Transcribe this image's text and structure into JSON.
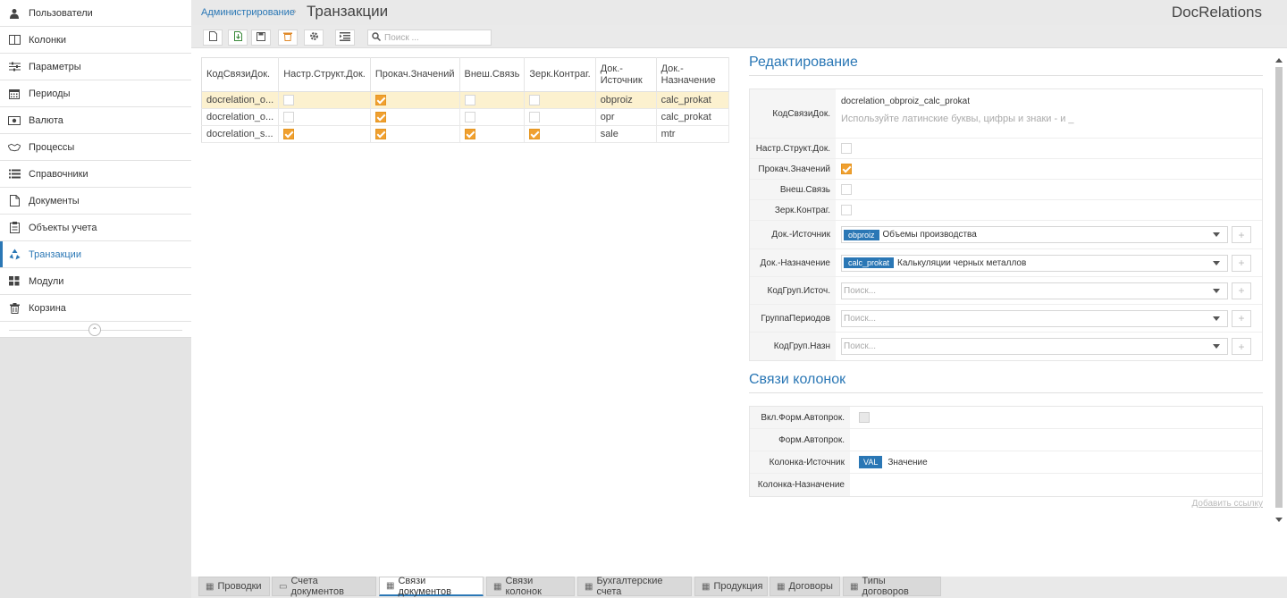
{
  "sidebar": {
    "items": [
      {
        "label": "Пользователи",
        "icon": "user-icon"
      },
      {
        "label": "Колонки",
        "icon": "columns-icon"
      },
      {
        "label": "Параметры",
        "icon": "sliders-icon"
      },
      {
        "label": "Периоды",
        "icon": "calendar-icon"
      },
      {
        "label": "Валюта",
        "icon": "money-icon"
      },
      {
        "label": "Процессы",
        "icon": "handshake-icon"
      },
      {
        "label": "Справочники",
        "icon": "list-icon"
      },
      {
        "label": "Документы",
        "icon": "document-icon"
      },
      {
        "label": "Объекты учета",
        "icon": "clipboard-icon"
      },
      {
        "label": "Транзакции",
        "icon": "recycle-icon",
        "active": true
      },
      {
        "label": "Модули",
        "icon": "grid-icon"
      },
      {
        "label": "Корзина",
        "icon": "trash-icon"
      }
    ]
  },
  "header": {
    "breadcrumb": "Администрирование",
    "separator": "›",
    "title": "Транзакции",
    "brand": "DocRelations"
  },
  "toolbar": {
    "search_placeholder": "Поиск ..."
  },
  "grid": {
    "columns": [
      "КодСвязиДок.",
      "Настр.Структ.Док.",
      "Прокач.Значений",
      "Внеш.Связь",
      "Зерк.Контраг.",
      "Док.-Источник",
      "Док.-Назначение"
    ],
    "rows": [
      {
        "code": "docrelation_o...",
        "nastr": false,
        "prokach": true,
        "vnesh": false,
        "zerk": false,
        "src": "obproiz",
        "dst": "calc_prokat",
        "selected": true
      },
      {
        "code": "docrelation_o...",
        "nastr": false,
        "prokach": true,
        "vnesh": false,
        "zerk": false,
        "src": "opr",
        "dst": "calc_prokat",
        "selected": false
      },
      {
        "code": "docrelation_s...",
        "nastr": true,
        "prokach": true,
        "vnesh": true,
        "zerk": true,
        "src": "sale",
        "dst": "mtr",
        "selected": false
      }
    ]
  },
  "edit": {
    "title": "Редактирование",
    "code_label": "КодСвязиДок.",
    "code_value": "docrelation_obproiz_calc_prokat",
    "code_hint": "Используйте латинские буквы, цифры и знаки - и _",
    "nastr_label": "Настр.Структ.Док.",
    "prokach_label": "Прокач.Значений",
    "vnesh_label": "Внеш.Связь",
    "zerk_label": "Зерк.Контраг.",
    "src_label": "Док.-Источник",
    "src_tag": "obproiz",
    "src_text": "Объемы производства",
    "dst_label": "Док.-Назначение",
    "dst_tag": "calc_prokat",
    "dst_text": "Калькуляции черных металлов",
    "grp_src_label": "КодГруп.Источ.",
    "grp_src_placeholder": "Поиск...",
    "period_label": "ГруппаПериодов",
    "period_placeholder": "Поиск...",
    "grp_dst_label": "КодГруп.Назн",
    "grp_dst_placeholder": "Поиск..."
  },
  "links": {
    "title": "Связи колонок",
    "auto_label": "Вкл.Форм.Автопрок.",
    "form_label": "Форм.Автопрок.",
    "col_src_label": "Колонка-Источник",
    "col_src_tag": "VAL",
    "col_src_text": "Значение",
    "col_dst_label": "Колонка-Назначение",
    "add_link": "Добавить ссылку"
  },
  "tabs": [
    {
      "label": "Проводки"
    },
    {
      "label": "Счета документов"
    },
    {
      "label": "Связи документов",
      "active": true
    },
    {
      "label": "Связи колонок"
    },
    {
      "label": "Бухгалтерские счета"
    },
    {
      "label": "Продукция"
    },
    {
      "label": "Договоры"
    },
    {
      "label": "Типы договоров"
    }
  ],
  "colors": {
    "accent": "#2a77b5",
    "checkbox_on": "#f0a030",
    "selected_row": "#fcf1cf"
  }
}
